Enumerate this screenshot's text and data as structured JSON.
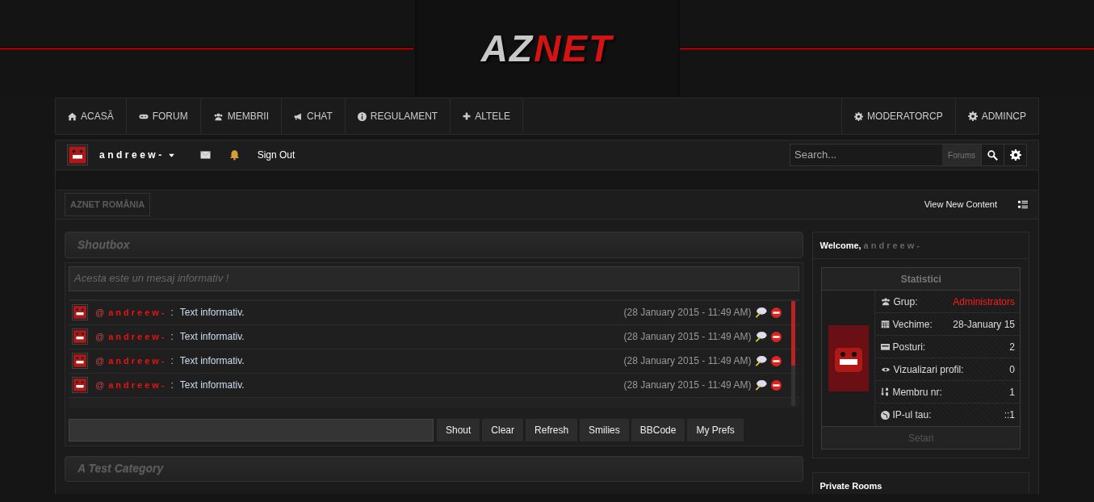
{
  "header": {
    "logo": [
      {
        "text": "AZ",
        "color": "#c8c8c8"
      },
      {
        "text": "NET",
        "color": "#d41414"
      }
    ]
  },
  "nav": {
    "left": [
      {
        "label": "ACASĂ"
      },
      {
        "label": "FORUM"
      },
      {
        "label": "MEMBRII"
      },
      {
        "label": "CHAT"
      },
      {
        "label": "REGULAMENT"
      },
      {
        "label": "ALTELE"
      }
    ],
    "right": [
      {
        "label": "MODERATORCP"
      },
      {
        "label": "ADMINCP"
      }
    ]
  },
  "user_bar": {
    "username": "andreew-",
    "sign_out": "Sign Out",
    "search": {
      "placeholder": "Search...",
      "scope": "Forums"
    }
  },
  "breadcrumb": {
    "label": "AZNET ROMÂNIA",
    "view_new_content": "View New Content"
  },
  "shoutbox": {
    "title": "Shoutbox",
    "notice": "Acesta este un mesaj informativ !",
    "shouts": [
      {
        "mention": "@",
        "user": "andreew-",
        "separator": ":",
        "text": "Text informativ.",
        "time": "(28 January 2015 - 11:49 AM)"
      },
      {
        "mention": "@",
        "user": "andreew-",
        "separator": ":",
        "text": "Text informativ.",
        "time": "(28 January 2015 - 11:49 AM)"
      },
      {
        "mention": "@",
        "user": "andreew-",
        "separator": ":",
        "text": "Text informativ.",
        "time": "(28 January 2015 - 11:49 AM)"
      },
      {
        "mention": "@",
        "user": "andreew-",
        "separator": ":",
        "text": "Text informativ.",
        "time": "(28 January 2015 - 11:49 AM)"
      }
    ],
    "buttons": [
      "Shout",
      "Clear",
      "Refresh",
      "Smilies",
      "BBCode",
      "My Prefs"
    ]
  },
  "category": {
    "title": "A Test Category"
  },
  "sidebar": {
    "welcome": {
      "label": "Welcome,",
      "user": "andreew-"
    },
    "stats": {
      "title": "Statistici",
      "rows": [
        {
          "label": "Grup:",
          "value": "Administrators",
          "color": "#ff1a1a"
        },
        {
          "label": "Vechime:",
          "value": "28-January 15",
          "color": "#dddddd"
        },
        {
          "label": "Posturi:",
          "value": "2",
          "color": "#dddddd"
        },
        {
          "label": "Vizualizari profil:",
          "value": "0",
          "color": "#dddddd"
        },
        {
          "label": "Membru nr:",
          "value": "1",
          "color": "#dddddd"
        },
        {
          "label": "IP-ul tau:",
          "value": "::1",
          "color": "#dddddd"
        }
      ],
      "footer": "Setari"
    },
    "private_rooms": {
      "title": "Private Rooms"
    }
  }
}
